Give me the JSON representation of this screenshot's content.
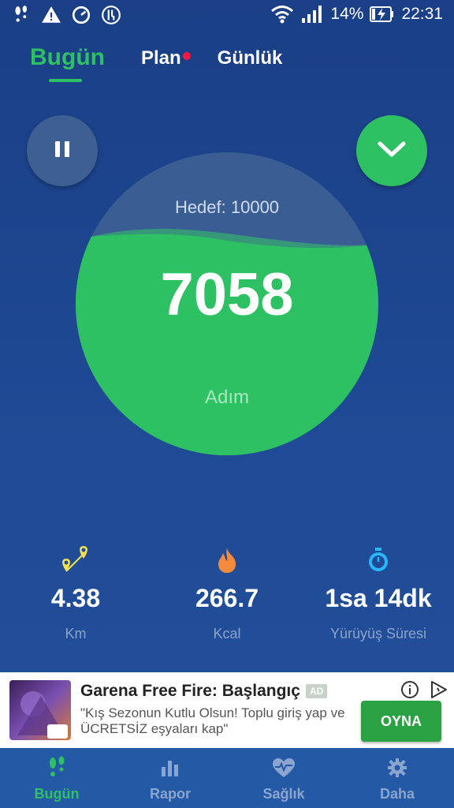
{
  "status_bar": {
    "battery": "14%",
    "time": "22:31"
  },
  "tabs": [
    {
      "label": "Bugün",
      "active": true
    },
    {
      "label": "Plan",
      "badge": true
    },
    {
      "label": "Günlük"
    }
  ],
  "gauge": {
    "goal_label": "Hedef: 10000",
    "steps": "7058",
    "unit": "Adım",
    "progress": 0.7058
  },
  "stats": [
    {
      "value": "4.38",
      "label": "Km",
      "icon": "route-pin-icon"
    },
    {
      "value": "266.7",
      "label": "Kcal",
      "icon": "flame-icon"
    },
    {
      "value": "1sa 14dk",
      "label": "Yürüyüş Süresi",
      "icon": "stopwatch-icon"
    }
  ],
  "ad": {
    "title": "Garena Free Fire: Başlangıç",
    "badge": "AD",
    "description": "\"Kış Sezonun Kutlu Olsun! Toplu giriş yap ve ÜCRETSİZ eşyaları kap\"",
    "cta": "OYNA"
  },
  "bottom_nav": [
    {
      "label": "Bugün",
      "icon": "footprints-icon",
      "active": true
    },
    {
      "label": "Rapor",
      "icon": "bar-chart-icon"
    },
    {
      "label": "Sağlık",
      "icon": "heart-pulse-icon"
    },
    {
      "label": "Daha",
      "icon": "gear-icon"
    }
  ],
  "colors": {
    "accent": "#2ec163",
    "background": "#1f4a95",
    "badge_red": "#ff1744"
  }
}
